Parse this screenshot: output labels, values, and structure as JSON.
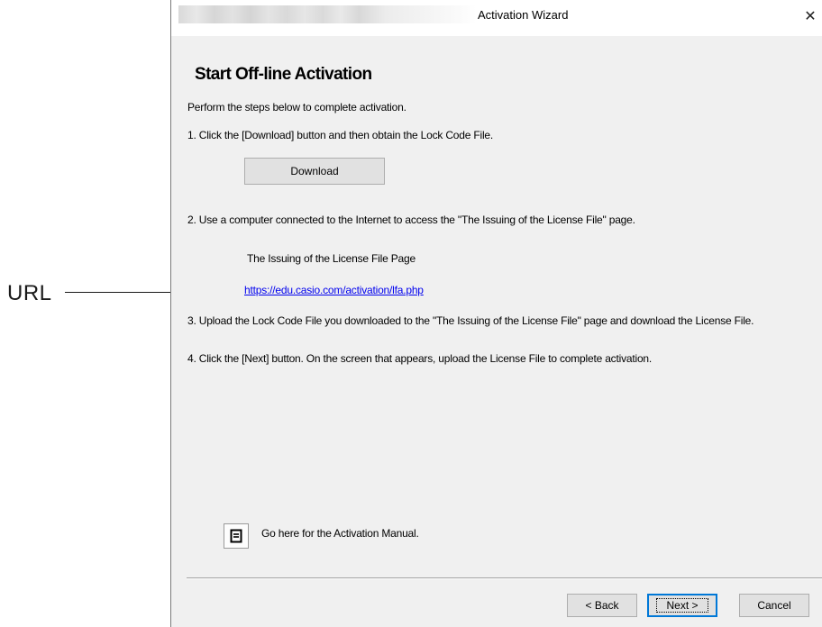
{
  "callout": {
    "label": "URL"
  },
  "window": {
    "title": "Activation Wizard",
    "close_glyph": "✕"
  },
  "page": {
    "heading": "Start Off-line Activation",
    "intro": "Perform the steps below to complete activation.",
    "step1": "1. Click the [Download] button and then obtain the Lock Code File.",
    "download_label": "Download",
    "step2": "2. Use a computer connected to the Internet to access the \"The Issuing of the License File\" page.",
    "issuing_label": "The Issuing of the License File Page",
    "url": "https://edu.casio.com/activation/lfa.php",
    "step3": "3. Upload the Lock Code File you downloaded to the \"The Issuing of the License File\" page and download the License File.",
    "step4": "4. Click the [Next] button. On the screen that appears, upload the License File to complete activation.",
    "manual_text": "Go here for the Activation Manual.",
    "manual_icon": "document-icon"
  },
  "footer": {
    "back_label": "< Back",
    "next_label": "Next >",
    "cancel_label": "Cancel"
  },
  "colors": {
    "window_bg": "#f0f0f0",
    "link": "#0000ee",
    "button_bg": "#e1e1e1",
    "focus_border": "#0078d7"
  }
}
